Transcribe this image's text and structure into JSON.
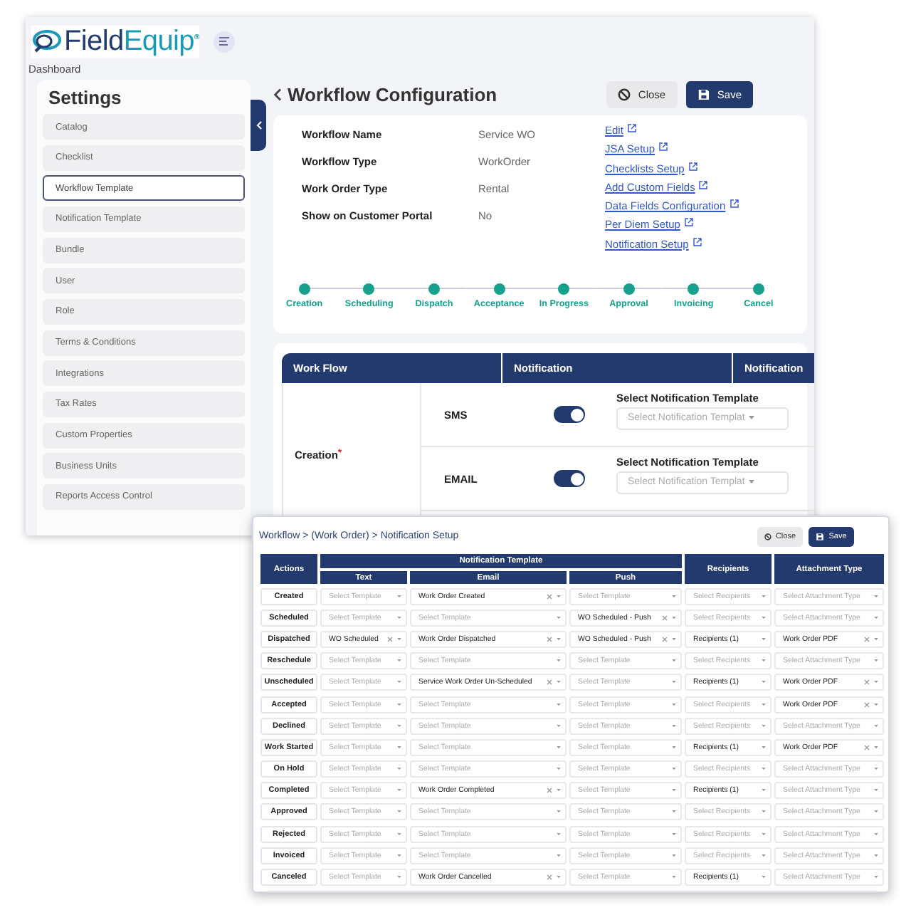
{
  "back_window": {
    "logo": "FieldEquip$^{®}$",
    "breadcrumb": "Dashboard",
    "sidebar": {
      "title": "Settings",
      "items": [
        {
          "label": "Catalog",
          "selected": false
        },
        {
          "label": "Checklist",
          "selected": false
        },
        {
          "label": "Workflow Template",
          "selected": true
        },
        {
          "label": "Notification Template",
          "selected": false
        },
        {
          "label": "Bundle",
          "selected": false
        },
        {
          "label": "User",
          "selected": false
        },
        {
          "label": "Role",
          "selected": false
        },
        {
          "label": "Terms & Conditions",
          "selected": false
        },
        {
          "label": "Integrations",
          "selected": false
        },
        {
          "label": "Tax Rates",
          "selected": false
        },
        {
          "label": "Custom Properties",
          "selected": false
        },
        {
          "label": "Business Units",
          "selected": false
        },
        {
          "label": "Reports Access Control",
          "selected": false
        }
      ]
    },
    "page": {
      "title": "Workflow Configuration",
      "buttons": [
        {
          "label": "Close",
          "kind": "close"
        },
        {
          "label": "Save",
          "kind": "save"
        }
      ],
      "fields": [
        {
          "label": "Workflow Name",
          "value": "Service WO"
        },
        {
          "label": "Workflow Type",
          "value": "WorkOrder"
        },
        {
          "label": "Work Order Type",
          "value": "Rental"
        },
        {
          "label": "Show on Customer Portal",
          "value": "No"
        }
      ],
      "links": [
        "Edit",
        "JSA Setup",
        "Checklists Setup",
        "Add Custom Fields",
        "Data Fields Configuration",
        "Per Diem Setup",
        "Notification Setup"
      ],
      "stages": [
        "Creation",
        "Scheduling",
        "Dispatch",
        "Acceptance",
        "In Progress",
        "Approval",
        "Invoicing",
        "Cancel"
      ]
    },
    "workflow_table": {
      "columns": [
        "Work Flow",
        "Notification",
        "Notification"
      ],
      "rows": [
        {
          "action": "Creation",
          "required_mark": "*",
          "channels": [
            {
              "name": "SMS",
              "on": true,
              "label": "Select Notification Template",
              "placeholder": "Select Notification Templat"
            },
            {
              "name": "EMAIL",
              "on": true,
              "label": "Select Notification Template",
              "placeholder": "Select Notification Templat"
            }
          ]
        }
      ]
    }
  },
  "front_window": {
    "breadcrumb": "Workflow > (Work Order) > Notification Setup",
    "buttons": [
      {
        "label": "Close",
        "kind": "close"
      },
      {
        "label": "Save",
        "kind": "save"
      }
    ],
    "group_header": "Notification Template",
    "columns": [
      {
        "label": "Actions",
        "grouped": false
      },
      {
        "label": "Text",
        "grouped": true
      },
      {
        "label": "Email",
        "grouped": true
      },
      {
        "label": "Push",
        "grouped": true
      },
      {
        "label": "Recipients",
        "grouped": false
      },
      {
        "label": "Attachment Type",
        "grouped": false
      }
    ],
    "rows": [
      {
        "cells": [
          {
            "kind": "label",
            "text": "Created"
          },
          {
            "placeholder": "Select Template",
            "clearable": false
          },
          {
            "value": "Work Order Created",
            "clearable": true
          },
          {
            "placeholder": "Select Template",
            "clearable": false
          },
          {
            "placeholder": "Select Recipients",
            "clearable": false
          },
          {
            "placeholder": "Select Attachment Type",
            "clearable": false
          }
        ]
      },
      {
        "cells": [
          {
            "kind": "label",
            "text": "Scheduled"
          },
          {
            "placeholder": "Select Template",
            "clearable": false
          },
          {
            "placeholder": "Select Template",
            "clearable": false
          },
          {
            "value": "WO Scheduled - Push",
            "clearable": true
          },
          {
            "placeholder": "Select Recipients",
            "clearable": false
          },
          {
            "placeholder": "Select Attachment Type",
            "clearable": false
          }
        ]
      },
      {
        "cells": [
          {
            "kind": "label",
            "text": "Dispatched"
          },
          {
            "value": "WO Scheduled",
            "clearable": true
          },
          {
            "value": "Work Order Dispatched",
            "clearable": true
          },
          {
            "value": "WO Scheduled - Push",
            "clearable": true
          },
          {
            "value": "Recipients (1)",
            "clearable": false
          },
          {
            "value": "Work Order PDF",
            "clearable": true
          }
        ]
      },
      {
        "cells": [
          {
            "kind": "label",
            "text": "Reschedule"
          },
          {
            "placeholder": "Select Template",
            "clearable": false
          },
          {
            "placeholder": "Select Template",
            "clearable": false
          },
          {
            "placeholder": "Select Template",
            "clearable": false
          },
          {
            "placeholder": "Select Recipients",
            "clearable": false
          },
          {
            "placeholder": "Select Attachment Type",
            "clearable": false
          }
        ]
      },
      {
        "cells": [
          {
            "kind": "label",
            "text": "Unscheduled"
          },
          {
            "placeholder": "Select Template",
            "clearable": false
          },
          {
            "value": "Service Work Order Un-Scheduled",
            "clearable": true
          },
          {
            "placeholder": "Select Template",
            "clearable": false
          },
          {
            "value": "Recipients (1)",
            "clearable": false
          },
          {
            "value": "Work Order PDF",
            "clearable": true
          }
        ]
      },
      {
        "cells": [
          {
            "kind": "label",
            "text": "Accepted"
          },
          {
            "placeholder": "Select Template",
            "clearable": false
          },
          {
            "placeholder": "Select Template",
            "clearable": false
          },
          {
            "placeholder": "Select Template",
            "clearable": false
          },
          {
            "placeholder": "Select Recipients",
            "clearable": false
          },
          {
            "value": "Work Order PDF",
            "clearable": true
          }
        ]
      },
      {
        "cells": [
          {
            "kind": "label",
            "text": "Declined"
          },
          {
            "placeholder": "Select Template",
            "clearable": false
          },
          {
            "placeholder": "Select Template",
            "clearable": false
          },
          {
            "placeholder": "Select Template",
            "clearable": false
          },
          {
            "placeholder": "Select Recipients",
            "clearable": false
          },
          {
            "placeholder": "Select Attachment Type",
            "clearable": false
          }
        ]
      },
      {
        "cells": [
          {
            "kind": "label",
            "text": "Work Started"
          },
          {
            "placeholder": "Select Template",
            "clearable": false
          },
          {
            "placeholder": "Select Template",
            "clearable": false
          },
          {
            "placeholder": "Select Template",
            "clearable": false
          },
          {
            "value": "Recipients (1)",
            "clearable": false
          },
          {
            "value": "Work Order PDF",
            "clearable": true
          }
        ]
      },
      {
        "cells": [
          {
            "kind": "label",
            "text": "On Hold"
          },
          {
            "placeholder": "Select Template",
            "clearable": false
          },
          {
            "placeholder": "Select Template",
            "clearable": false
          },
          {
            "placeholder": "Select Template",
            "clearable": false
          },
          {
            "placeholder": "Select Recipients",
            "clearable": false
          },
          {
            "placeholder": "Select Attachment Type",
            "clearable": false
          }
        ]
      },
      {
        "cells": [
          {
            "kind": "label",
            "text": "Completed"
          },
          {
            "placeholder": "Select Template",
            "clearable": false
          },
          {
            "value": "Work Order Completed",
            "clearable": true
          },
          {
            "placeholder": "Select Template",
            "clearable": false
          },
          {
            "value": "Recipients (1)",
            "clearable": false
          },
          {
            "placeholder": "Select Attachment Type",
            "clearable": false
          }
        ]
      },
      {
        "cells": [
          {
            "kind": "label",
            "text": "Approved"
          },
          {
            "placeholder": "Select Template",
            "clearable": false
          },
          {
            "placeholder": "Select Template",
            "clearable": false
          },
          {
            "placeholder": "Select Template",
            "clearable": false
          },
          {
            "placeholder": "Select Recipients",
            "clearable": false
          },
          {
            "placeholder": "Select Attachment Type",
            "clearable": false
          }
        ]
      },
      {
        "cells": [
          {
            "kind": "label",
            "text": "Rejected"
          },
          {
            "placeholder": "Select Template",
            "clearable": false
          },
          {
            "placeholder": "Select Template",
            "clearable": false
          },
          {
            "placeholder": "Select Template",
            "clearable": false
          },
          {
            "placeholder": "Select Recipients",
            "clearable": false
          },
          {
            "placeholder": "Select Attachment Type",
            "clearable": false
          }
        ]
      },
      {
        "cells": [
          {
            "kind": "label",
            "text": "Invoiced"
          },
          {
            "placeholder": "Select Template",
            "clearable": false
          },
          {
            "placeholder": "Select Template",
            "clearable": false
          },
          {
            "placeholder": "Select Template",
            "clearable": false
          },
          {
            "placeholder": "Select Recipients",
            "clearable": false
          },
          {
            "placeholder": "Select Attachment Type",
            "clearable": false
          }
        ]
      },
      {
        "cells": [
          {
            "kind": "label",
            "text": "Canceled"
          },
          {
            "placeholder": "Select Template",
            "clearable": false
          },
          {
            "value": "Work Order Cancelled",
            "clearable": true
          },
          {
            "placeholder": "Select Template",
            "clearable": false
          },
          {
            "value": "Recipients (1)",
            "clearable": false
          },
          {
            "placeholder": "Select Attachment Type",
            "clearable": false
          }
        ]
      }
    ]
  }
}
